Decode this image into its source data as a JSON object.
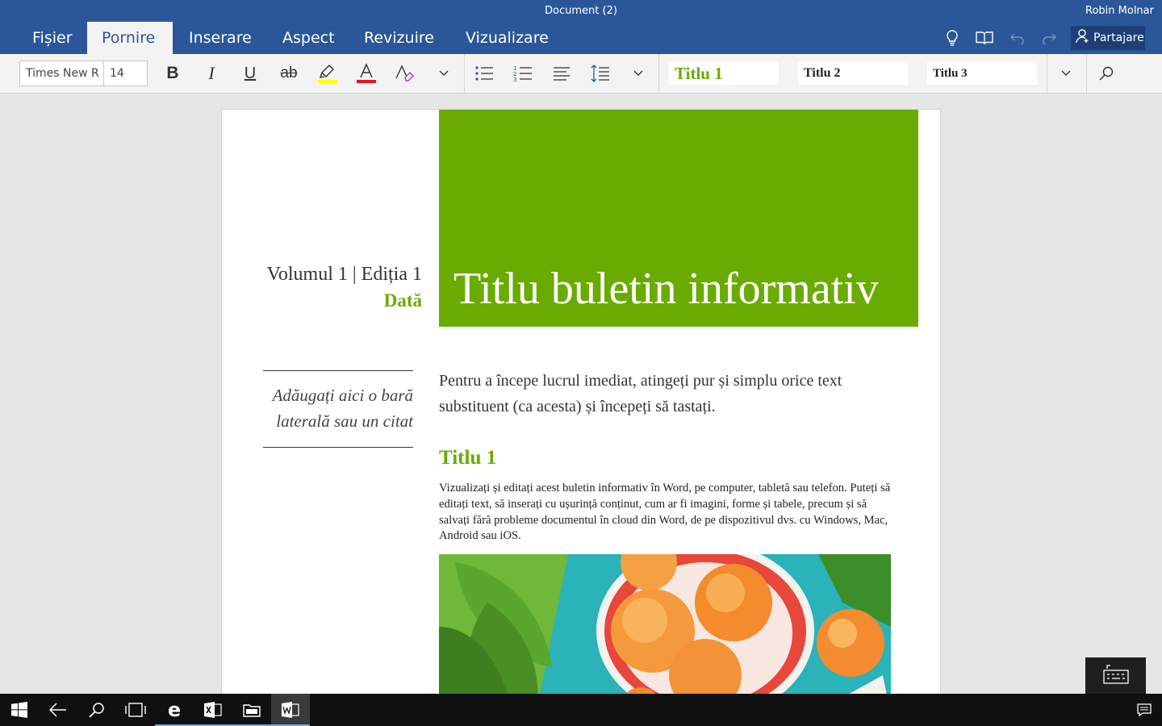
{
  "window": {
    "title": "Document (2)",
    "user": "Robin Molnar"
  },
  "tabs": [
    "Fișier",
    "Pornire",
    "Inserare",
    "Aspect",
    "Revizuire",
    "Vizualizare"
  ],
  "active_tab": "Pornire",
  "share_label": "Partajare",
  "ribbon": {
    "font_name": "Times New R",
    "font_size": "14",
    "styles": [
      "Titlu 1",
      "Titlu 2",
      "Titlu 3"
    ]
  },
  "colors": {
    "accent": "#2b579a",
    "banner": "#6aab00",
    "highlight": "#ffff00",
    "font_color": "#e81123"
  },
  "document": {
    "volume": "Volumul 1 | Ediția 1",
    "date": "Dată",
    "banner_title": "Titlu buletin informativ",
    "sidebar_quote": "Adăugați aici o bară laterală sau un citat",
    "intro": "Pentru a începe lucrul imediat, atingeți pur și simplu orice text substituent (ca acesta) și începeți să tastați.",
    "heading1": "Titlu 1",
    "body": "Vizualizați și editați acest buletin informativ în Word, pe computer, tabletă sau telefon. Puteți să editați text, să inserați cu ușurință conținut, cum ar fi imagini, forme și tabele, precum și să salvați fără probleme documentul în cloud din Word, de pe dispozitivul dvs. cu Windows, Mac, Android sau iOS."
  },
  "taskbar": [
    "start-icon",
    "back-icon",
    "search-icon",
    "task-view-icon",
    "edge-icon",
    "excel-icon",
    "file-explorer-icon",
    "word-icon",
    "action-center-icon"
  ]
}
